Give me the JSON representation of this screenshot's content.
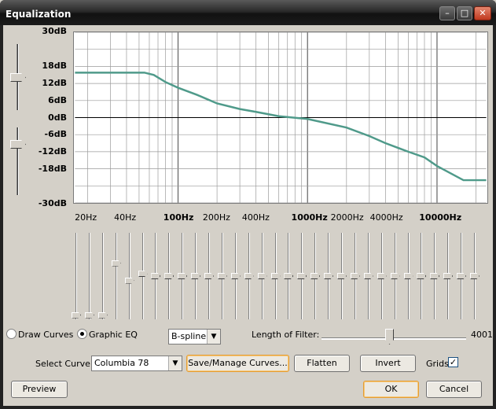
{
  "window": {
    "title": "Equalization"
  },
  "titlebar": {
    "min": "–",
    "max": "□",
    "close": "✕"
  },
  "graph": {
    "db_ticks": [
      "30dB",
      "18dB",
      "12dB",
      "6dB",
      "0dB",
      "-6dB",
      "-12dB",
      "-18dB",
      "-30dB"
    ],
    "hz_ticks": [
      "20Hz",
      "40Hz",
      "100Hz",
      "200Hz",
      "400Hz",
      "1000Hz",
      "2000Hz",
      "4000Hz",
      "10000Hz"
    ],
    "curve_color": "#4f9a8a",
    "grid_color": "#9a9a9a"
  },
  "chart_data": {
    "type": "line",
    "title": "",
    "xlabel": "",
    "ylabel": "",
    "xscale": "log",
    "xlim": [
      16,
      24000
    ],
    "ylim": [
      -30,
      30
    ],
    "grid": true,
    "series": [
      {
        "x": [
          16,
          55,
          65,
          80,
          100,
          140,
          200,
          300,
          400,
          600,
          1000,
          2000,
          3000,
          4000,
          6000,
          8000,
          10000,
          16000,
          24000
        ],
        "values": [
          15.8,
          15.8,
          15,
          12.5,
          10.5,
          8,
          5,
          3,
          2,
          0.5,
          -0.5,
          -3.5,
          -6.5,
          -9,
          -12,
          -14,
          -17,
          -22,
          -22
        ]
      }
    ]
  },
  "controls": {
    "draw_curves": "Draw Curves",
    "graphic_eq": "Graphic EQ",
    "interp": "B-spline",
    "length_label": "Length of Filter:",
    "length_value": "4001",
    "select_curve_label": "Select Curve:",
    "select_curve_value": "Columbia 78",
    "save_manage": "Save/Manage Curves...",
    "flatten": "Flatten",
    "invert": "Invert",
    "grids": "Grids",
    "grids_checked": "✓",
    "preview": "Preview",
    "ok": "OK",
    "cancel": "Cancel"
  },
  "bands": {
    "values_db": [
      -18,
      -18,
      -18,
      6,
      -2,
      1,
      0,
      0,
      0,
      0,
      0,
      0,
      0,
      0,
      0,
      0,
      0,
      0,
      0,
      0,
      0,
      0,
      0,
      0,
      0,
      0,
      0,
      0,
      0,
      0,
      0
    ]
  }
}
